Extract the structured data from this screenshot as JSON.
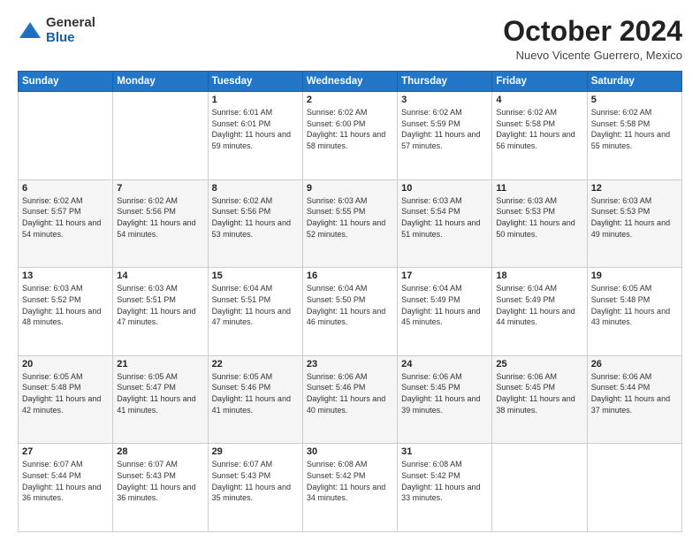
{
  "logo": {
    "general": "General",
    "blue": "Blue"
  },
  "title": "October 2024",
  "subtitle": "Nuevo Vicente Guerrero, Mexico",
  "days_of_week": [
    "Sunday",
    "Monday",
    "Tuesday",
    "Wednesday",
    "Thursday",
    "Friday",
    "Saturday"
  ],
  "weeks": [
    [
      {
        "day": "",
        "info": ""
      },
      {
        "day": "",
        "info": ""
      },
      {
        "day": "1",
        "info": "Sunrise: 6:01 AM\nSunset: 6:01 PM\nDaylight: 11 hours and 59 minutes."
      },
      {
        "day": "2",
        "info": "Sunrise: 6:02 AM\nSunset: 6:00 PM\nDaylight: 11 hours and 58 minutes."
      },
      {
        "day": "3",
        "info": "Sunrise: 6:02 AM\nSunset: 5:59 PM\nDaylight: 11 hours and 57 minutes."
      },
      {
        "day": "4",
        "info": "Sunrise: 6:02 AM\nSunset: 5:58 PM\nDaylight: 11 hours and 56 minutes."
      },
      {
        "day": "5",
        "info": "Sunrise: 6:02 AM\nSunset: 5:58 PM\nDaylight: 11 hours and 55 minutes."
      }
    ],
    [
      {
        "day": "6",
        "info": "Sunrise: 6:02 AM\nSunset: 5:57 PM\nDaylight: 11 hours and 54 minutes."
      },
      {
        "day": "7",
        "info": "Sunrise: 6:02 AM\nSunset: 5:56 PM\nDaylight: 11 hours and 54 minutes."
      },
      {
        "day": "8",
        "info": "Sunrise: 6:02 AM\nSunset: 5:56 PM\nDaylight: 11 hours and 53 minutes."
      },
      {
        "day": "9",
        "info": "Sunrise: 6:03 AM\nSunset: 5:55 PM\nDaylight: 11 hours and 52 minutes."
      },
      {
        "day": "10",
        "info": "Sunrise: 6:03 AM\nSunset: 5:54 PM\nDaylight: 11 hours and 51 minutes."
      },
      {
        "day": "11",
        "info": "Sunrise: 6:03 AM\nSunset: 5:53 PM\nDaylight: 11 hours and 50 minutes."
      },
      {
        "day": "12",
        "info": "Sunrise: 6:03 AM\nSunset: 5:53 PM\nDaylight: 11 hours and 49 minutes."
      }
    ],
    [
      {
        "day": "13",
        "info": "Sunrise: 6:03 AM\nSunset: 5:52 PM\nDaylight: 11 hours and 48 minutes."
      },
      {
        "day": "14",
        "info": "Sunrise: 6:03 AM\nSunset: 5:51 PM\nDaylight: 11 hours and 47 minutes."
      },
      {
        "day": "15",
        "info": "Sunrise: 6:04 AM\nSunset: 5:51 PM\nDaylight: 11 hours and 47 minutes."
      },
      {
        "day": "16",
        "info": "Sunrise: 6:04 AM\nSunset: 5:50 PM\nDaylight: 11 hours and 46 minutes."
      },
      {
        "day": "17",
        "info": "Sunrise: 6:04 AM\nSunset: 5:49 PM\nDaylight: 11 hours and 45 minutes."
      },
      {
        "day": "18",
        "info": "Sunrise: 6:04 AM\nSunset: 5:49 PM\nDaylight: 11 hours and 44 minutes."
      },
      {
        "day": "19",
        "info": "Sunrise: 6:05 AM\nSunset: 5:48 PM\nDaylight: 11 hours and 43 minutes."
      }
    ],
    [
      {
        "day": "20",
        "info": "Sunrise: 6:05 AM\nSunset: 5:48 PM\nDaylight: 11 hours and 42 minutes."
      },
      {
        "day": "21",
        "info": "Sunrise: 6:05 AM\nSunset: 5:47 PM\nDaylight: 11 hours and 41 minutes."
      },
      {
        "day": "22",
        "info": "Sunrise: 6:05 AM\nSunset: 5:46 PM\nDaylight: 11 hours and 41 minutes."
      },
      {
        "day": "23",
        "info": "Sunrise: 6:06 AM\nSunset: 5:46 PM\nDaylight: 11 hours and 40 minutes."
      },
      {
        "day": "24",
        "info": "Sunrise: 6:06 AM\nSunset: 5:45 PM\nDaylight: 11 hours and 39 minutes."
      },
      {
        "day": "25",
        "info": "Sunrise: 6:06 AM\nSunset: 5:45 PM\nDaylight: 11 hours and 38 minutes."
      },
      {
        "day": "26",
        "info": "Sunrise: 6:06 AM\nSunset: 5:44 PM\nDaylight: 11 hours and 37 minutes."
      }
    ],
    [
      {
        "day": "27",
        "info": "Sunrise: 6:07 AM\nSunset: 5:44 PM\nDaylight: 11 hours and 36 minutes."
      },
      {
        "day": "28",
        "info": "Sunrise: 6:07 AM\nSunset: 5:43 PM\nDaylight: 11 hours and 36 minutes."
      },
      {
        "day": "29",
        "info": "Sunrise: 6:07 AM\nSunset: 5:43 PM\nDaylight: 11 hours and 35 minutes."
      },
      {
        "day": "30",
        "info": "Sunrise: 6:08 AM\nSunset: 5:42 PM\nDaylight: 11 hours and 34 minutes."
      },
      {
        "day": "31",
        "info": "Sunrise: 6:08 AM\nSunset: 5:42 PM\nDaylight: 11 hours and 33 minutes."
      },
      {
        "day": "",
        "info": ""
      },
      {
        "day": "",
        "info": ""
      }
    ]
  ]
}
